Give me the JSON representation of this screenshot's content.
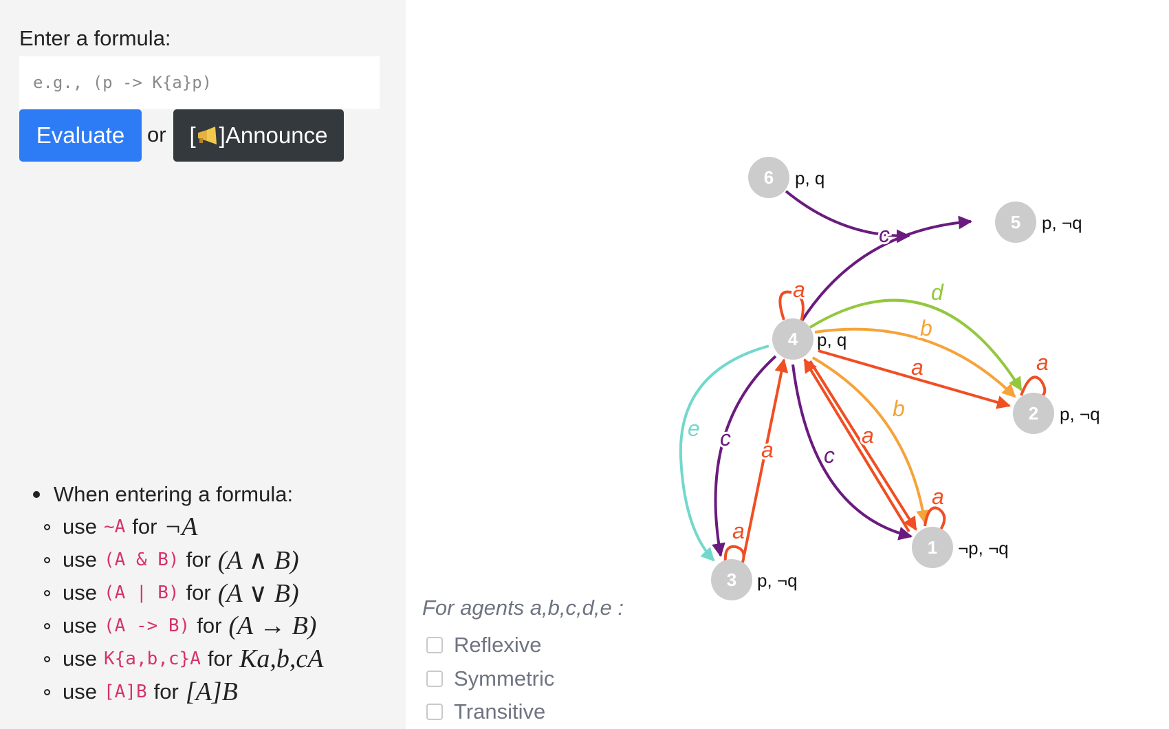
{
  "form": {
    "label": "Enter a formula:",
    "placeholder": "e.g., (p -> K{a}p)",
    "evaluate_label": "Evaluate",
    "or_label": "or",
    "announce_label": "]Announce",
    "announce_prefix": "["
  },
  "help": {
    "heading": "When entering a formula:",
    "items": [
      {
        "use": "use",
        "code": "~A",
        "for": "for",
        "math": "¬A"
      },
      {
        "use": "use",
        "code": "(A & B)",
        "for": "for",
        "math": "(A ∧ B)"
      },
      {
        "use": "use",
        "code": "(A | B)",
        "for": "for",
        "math": "(A ∨ B)"
      },
      {
        "use": "use",
        "code": "(A -> B)",
        "for": "for",
        "math": "(A → B)"
      },
      {
        "use": "use",
        "code": "K{a,b,c}A",
        "for": "for",
        "math": "Ka,b,cA"
      },
      {
        "use": "use",
        "code": "[A]B",
        "for": "for",
        "math": "[A]B"
      }
    ]
  },
  "agents": {
    "label": "For agents a,b,c,d,e :",
    "options": [
      "Reflexive",
      "Symmetric",
      "Transitive"
    ]
  },
  "graph": {
    "nodes": [
      {
        "id": "1",
        "props": "¬p, ¬q"
      },
      {
        "id": "2",
        "props": "p, ¬q"
      },
      {
        "id": "3",
        "props": "p, ¬q"
      },
      {
        "id": "4",
        "props": "p, q"
      },
      {
        "id": "5",
        "props": "p, ¬q"
      },
      {
        "id": "6",
        "props": "p, q"
      }
    ],
    "agent_colors": {
      "a": "#f04e23",
      "b": "#f5a33a",
      "c": "#6a1b7e",
      "d": "#93c83e",
      "e": "#72d8cc"
    }
  }
}
